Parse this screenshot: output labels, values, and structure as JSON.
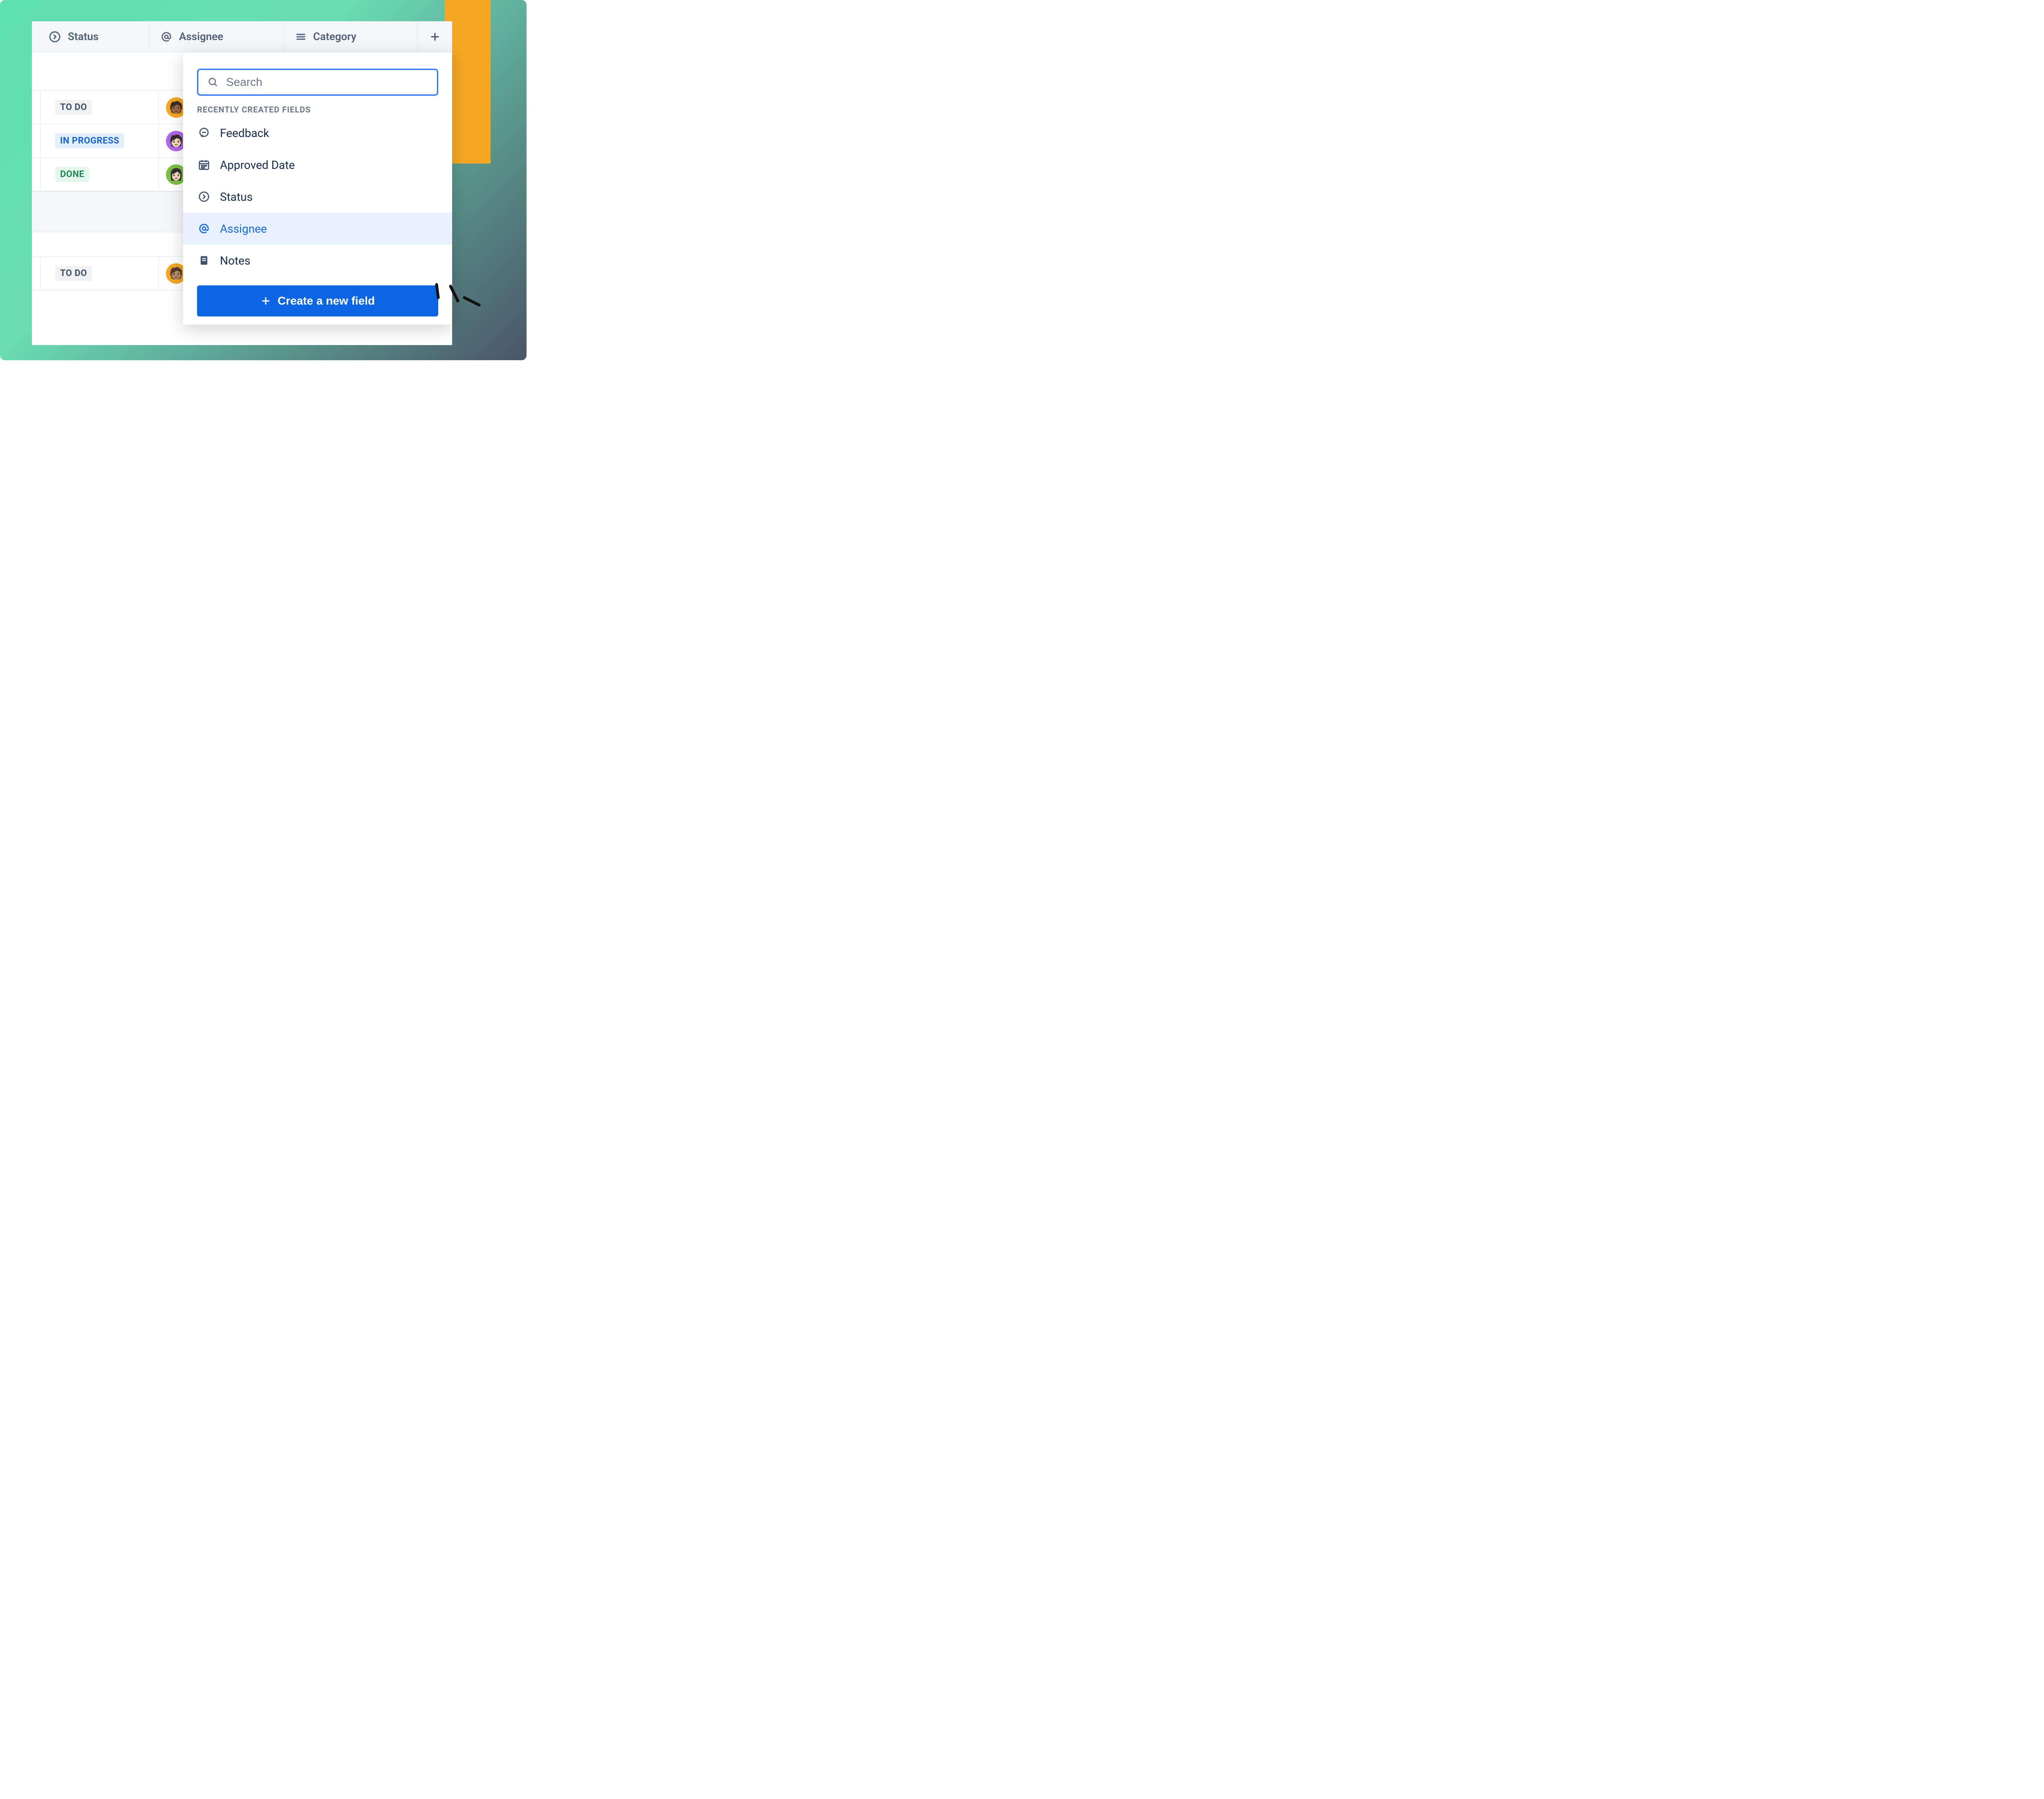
{
  "columns": [
    {
      "icon": "arrow-circle",
      "label": "Status"
    },
    {
      "icon": "at",
      "label": "Assignee"
    },
    {
      "icon": "lines",
      "label": "Category"
    }
  ],
  "rows_group1": [
    {
      "status": "TO DO",
      "status_class": "todo",
      "avatar_bg": "#f5a623"
    },
    {
      "status": "IN PROGRESS",
      "status_class": "progress",
      "avatar_bg": "#b265e8"
    },
    {
      "status": "DONE",
      "status_class": "done",
      "avatar_bg": "#7bc043"
    }
  ],
  "rows_group2": [
    {
      "status": "TO DO",
      "status_class": "todo",
      "avatar_bg": "#f5a623"
    }
  ],
  "dropdown": {
    "search_placeholder": "Search",
    "section_label": "RECENTLY CREATED FIELDS",
    "items": [
      {
        "icon": "chat",
        "label": "Feedback",
        "active": false
      },
      {
        "icon": "calendar",
        "label": "Approved Date",
        "active": false
      },
      {
        "icon": "arrow-circle",
        "label": "Status",
        "active": false
      },
      {
        "icon": "at",
        "label": "Assignee",
        "active": true
      },
      {
        "icon": "note",
        "label": "Notes",
        "active": false
      }
    ],
    "create_label": "Create a new field"
  }
}
